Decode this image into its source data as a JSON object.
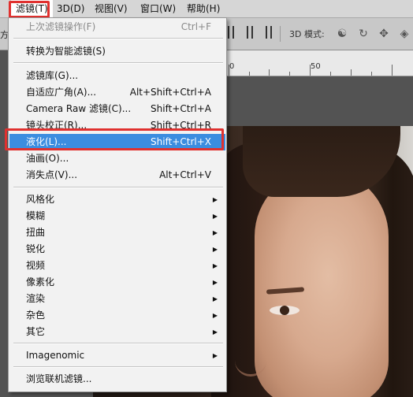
{
  "menubar": {
    "items": [
      {
        "label": "滤镜(T)",
        "active": true
      },
      {
        "label": "3D(D)"
      },
      {
        "label": "视图(V)"
      },
      {
        "label": "窗口(W)"
      },
      {
        "label": "帮助(H)"
      }
    ]
  },
  "optionsbar": {
    "left_sliver": "方",
    "mode3d_label": "3D 模式:",
    "icons3d": [
      "rotate-3d-icon",
      "roll-3d-icon",
      "pan-3d-icon",
      "slide-3d-icon",
      "scale-3d-icon"
    ]
  },
  "ruler": {
    "labels": [
      "0",
      "50"
    ]
  },
  "filter_menu": {
    "groups": [
      [
        {
          "label": "上次滤镜操作(F)",
          "shortcut": "Ctrl+F",
          "disabled": true
        }
      ],
      [
        {
          "label": "转换为智能滤镜(S)",
          "shortcut": ""
        }
      ],
      [
        {
          "label": "滤镜库(G)...",
          "shortcut": ""
        },
        {
          "label": "自适应广角(A)...",
          "shortcut": "Alt+Shift+Ctrl+A"
        },
        {
          "label": "Camera Raw 滤镜(C)...",
          "shortcut": "Shift+Ctrl+A"
        },
        {
          "label": "镜头校正(R)...",
          "shortcut": "Shift+Ctrl+R"
        },
        {
          "label": "液化(L)...",
          "shortcut": "Shift+Ctrl+X",
          "highlighted": true
        },
        {
          "label": "油画(O)...",
          "shortcut": ""
        },
        {
          "label": "消失点(V)...",
          "shortcut": "Alt+Ctrl+V"
        }
      ],
      [
        {
          "label": "风格化",
          "submenu": true
        },
        {
          "label": "模糊",
          "submenu": true
        },
        {
          "label": "扭曲",
          "submenu": true
        },
        {
          "label": "锐化",
          "submenu": true
        },
        {
          "label": "视频",
          "submenu": true
        },
        {
          "label": "像素化",
          "submenu": true
        },
        {
          "label": "渲染",
          "submenu": true
        },
        {
          "label": "杂色",
          "submenu": true
        },
        {
          "label": "其它",
          "submenu": true
        }
      ],
      [
        {
          "label": "Imagenomic",
          "submenu": true
        }
      ],
      [
        {
          "label": "浏览联机滤镜...",
          "shortcut": ""
        }
      ]
    ]
  },
  "colors": {
    "highlight": "#3b8de0",
    "annotation_red": "#e0312f",
    "menu_bg": "#f2f2f2",
    "menubar_bg": "#d6d6d6"
  }
}
